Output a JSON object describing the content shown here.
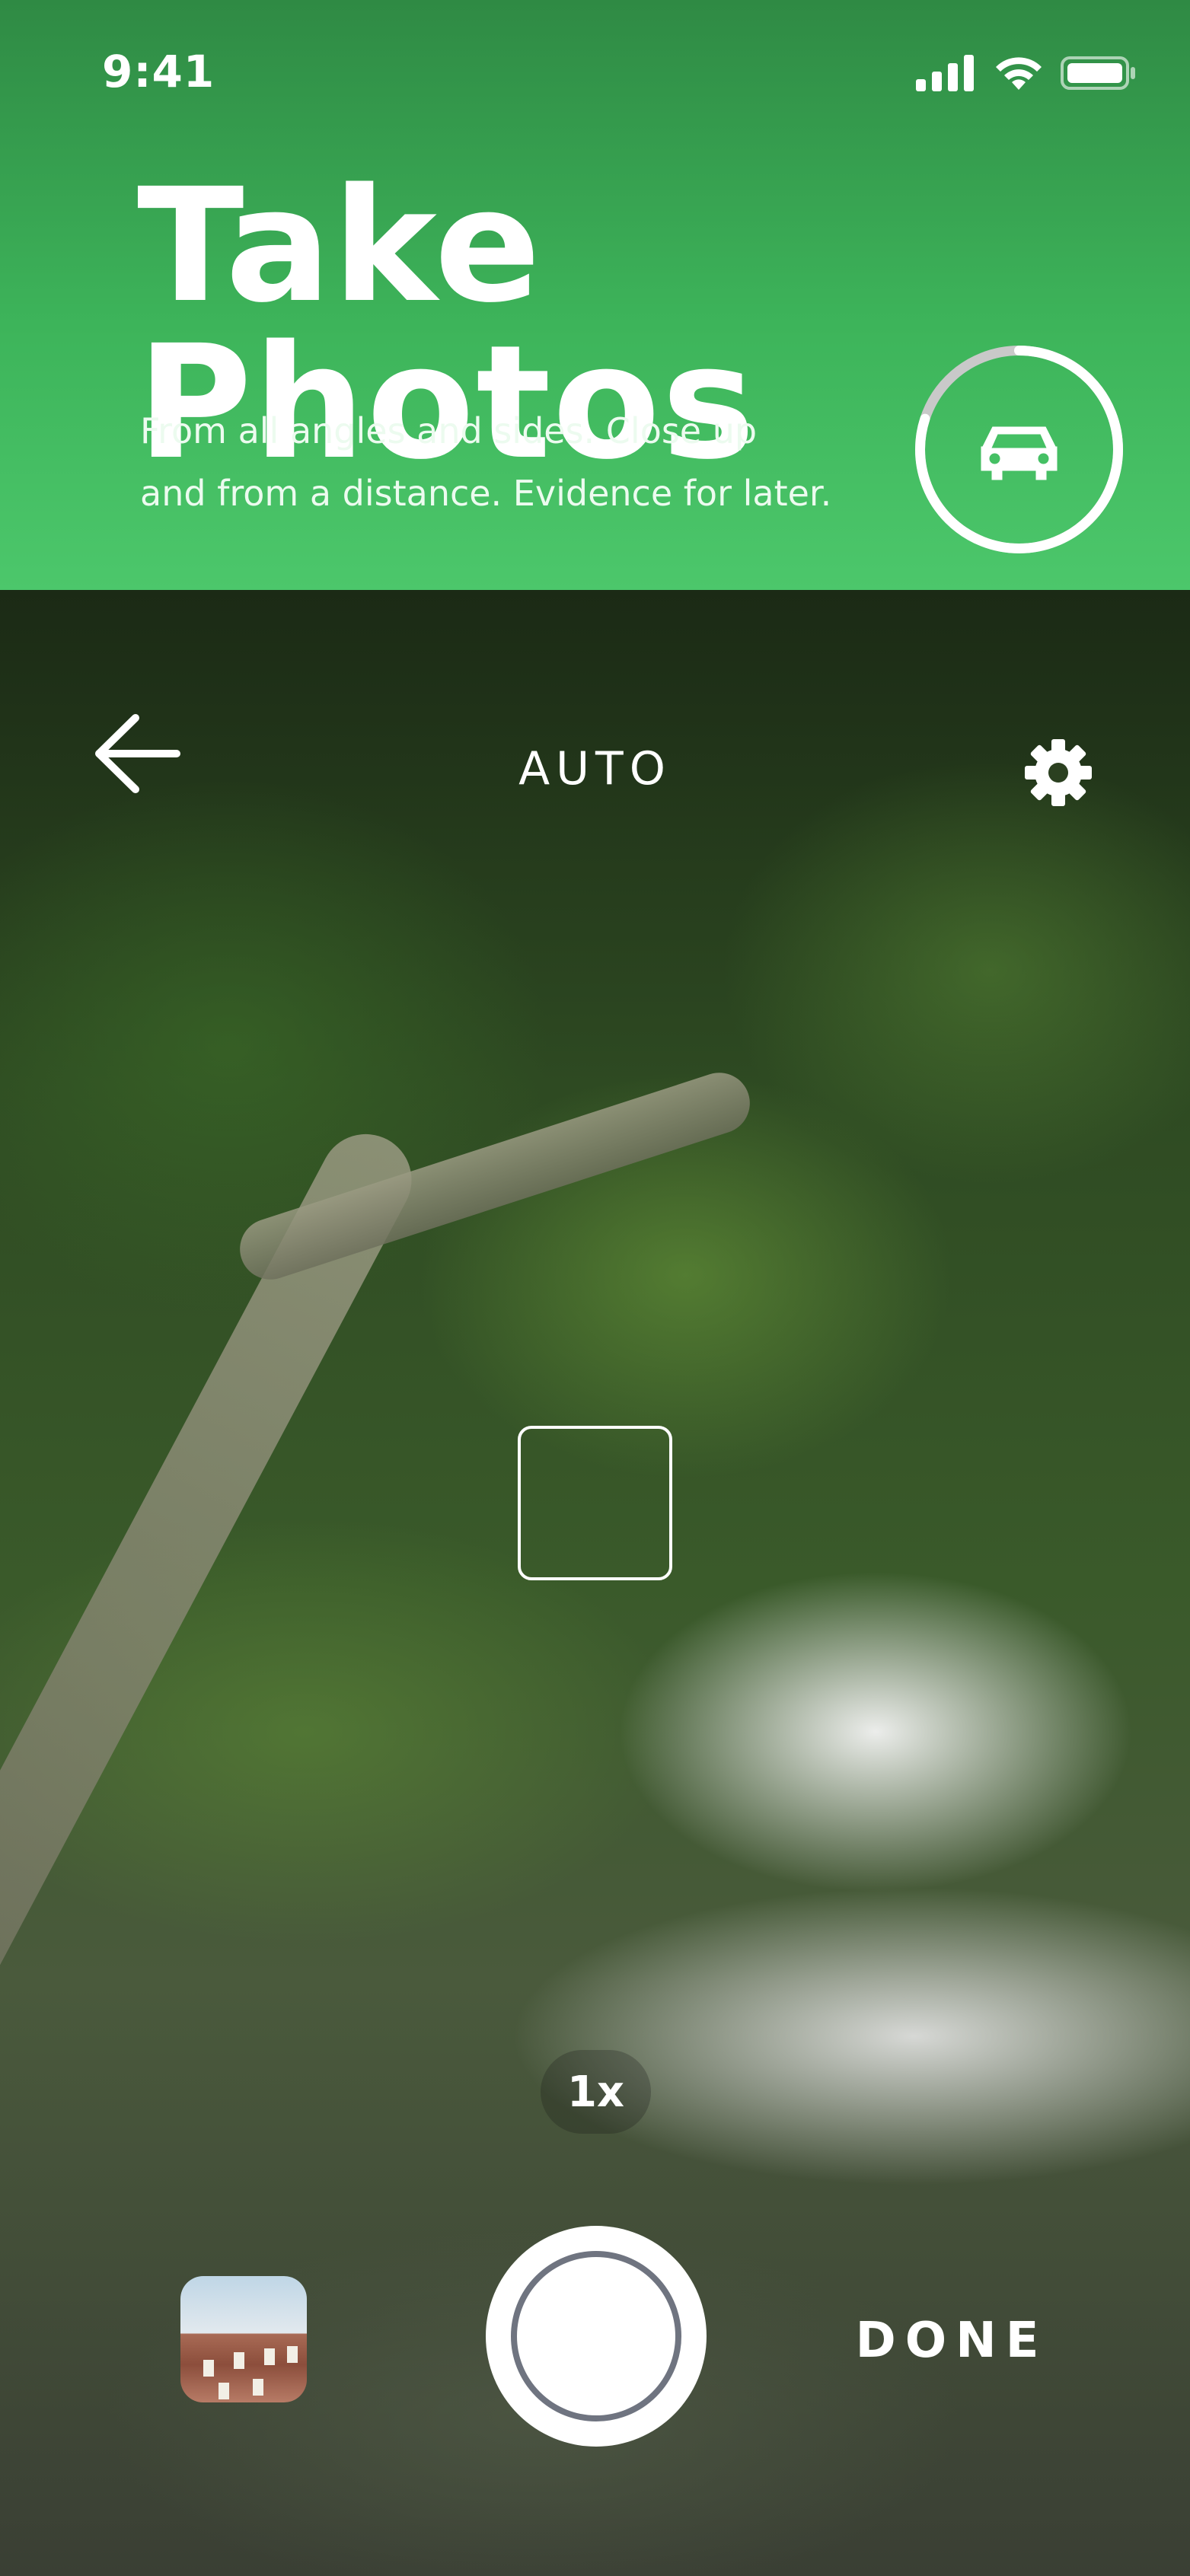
{
  "status_bar": {
    "time": "9:41",
    "icons": [
      "cellular-signal-icon",
      "wifi-icon",
      "battery-icon"
    ]
  },
  "header": {
    "title": "Take Photos",
    "subtitle_line1": "From all angles and sides. Close up",
    "subtitle_line2": "and from a distance. Evidence for later.",
    "progress_fraction": 0.8,
    "progress_icon": "car-icon",
    "accent_color": "#3db45a"
  },
  "camera": {
    "mode_label": "AUTO",
    "back_icon": "arrow-left-icon",
    "settings_icon": "gear-icon",
    "zoom_label": "1x",
    "done_label": "DONE"
  }
}
